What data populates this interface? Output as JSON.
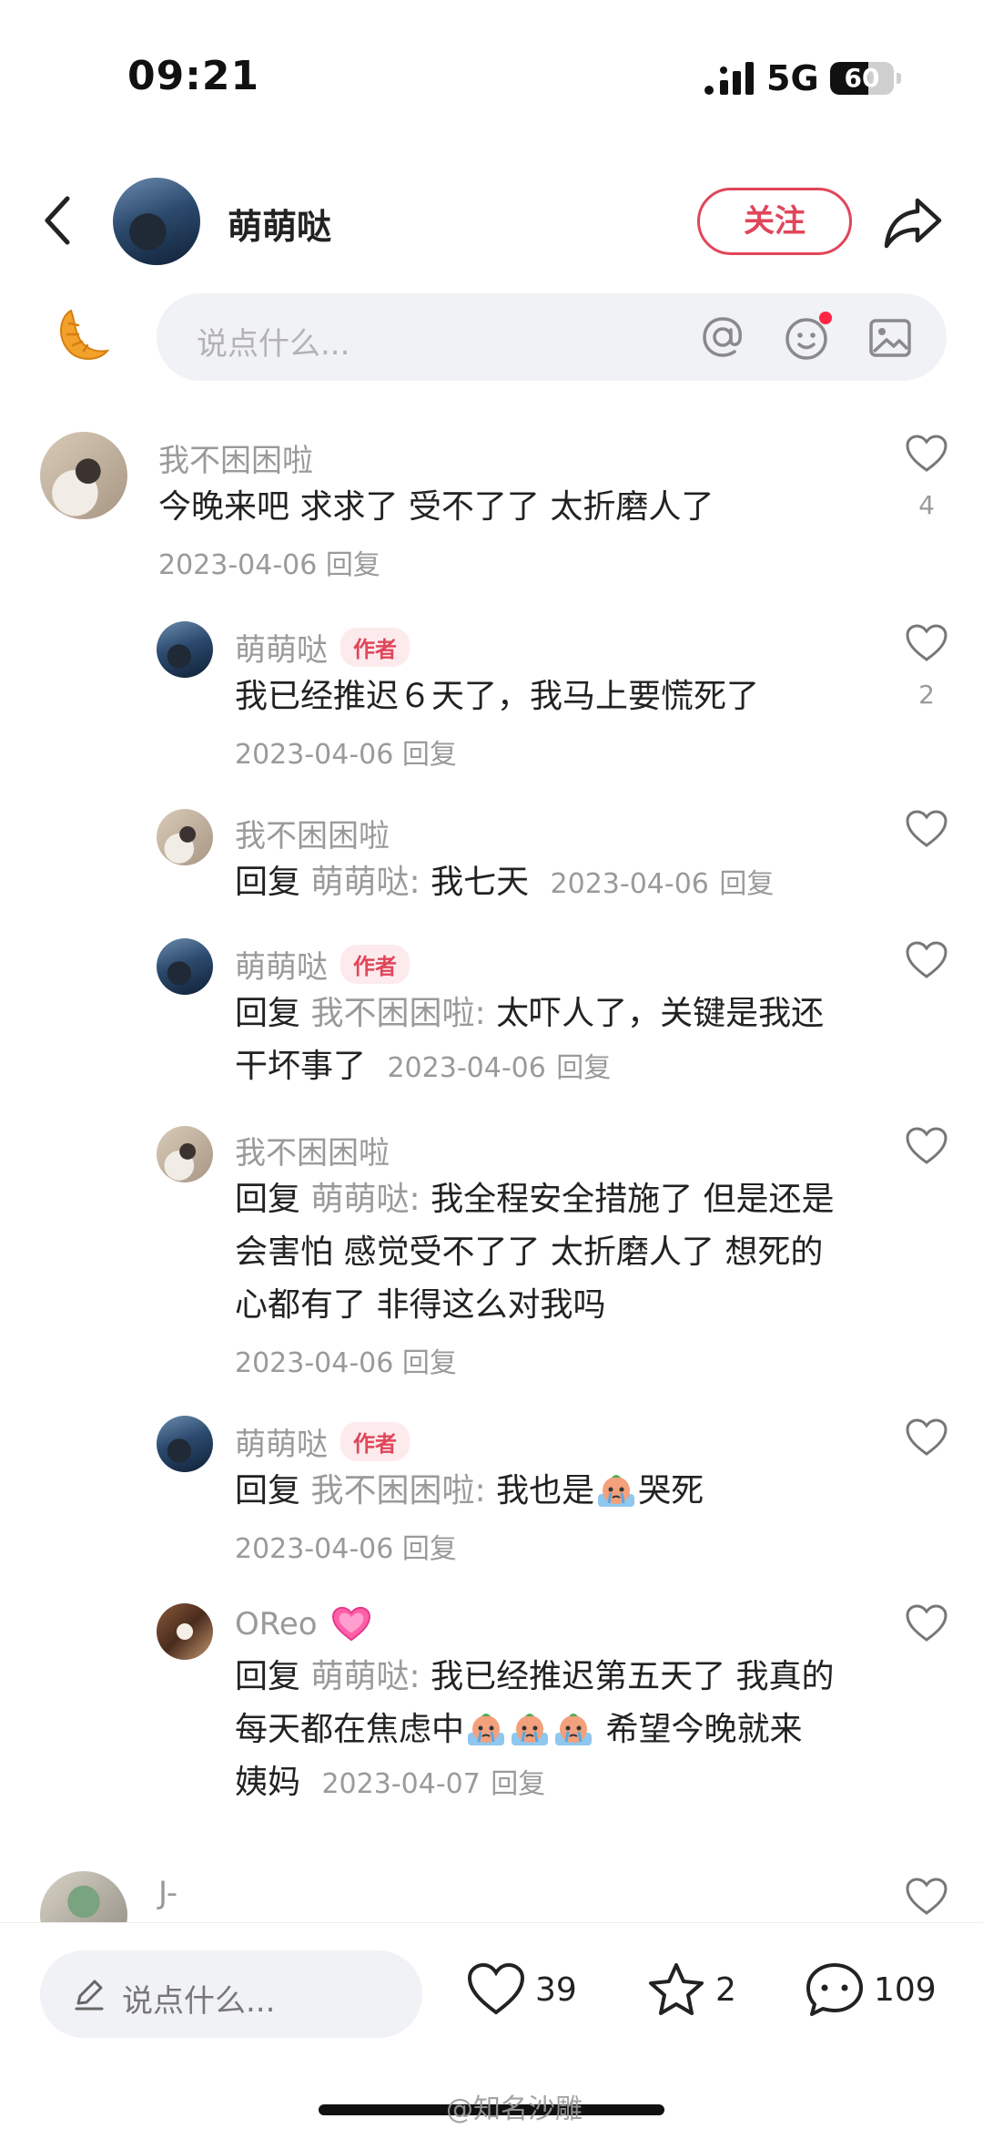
{
  "status_bar": {
    "time": "09:21",
    "network": "5G",
    "battery": "60",
    "battery_level": 0.6
  },
  "header": {
    "author_name": "萌萌哒",
    "follow_label": "关注"
  },
  "top_input": {
    "placeholder": "说点什么..."
  },
  "comments": [
    {
      "name": "我不困困啦",
      "text": "今晚来吧 求求了 受不了了 太折磨人了",
      "date": "2023-04-06",
      "reply_label": "回复",
      "likes": "4"
    },
    {
      "name": "萌萌哒",
      "tag": "作者",
      "text": "我已经推迟６天了，我马上要慌死了",
      "date": "2023-04-06",
      "reply_label": "回复",
      "likes": "2"
    },
    {
      "name": "我不困困啦",
      "prefix": "回复",
      "target": "萌萌哒:",
      "text": "我七天",
      "date": "2023-04-06",
      "reply_label": "回复"
    },
    {
      "name": "萌萌哒",
      "tag": "作者",
      "prefix": "回复",
      "target": "我不困困啦:",
      "text_line1": "太吓人了，关键是我还",
      "text_line2": "干坏事了",
      "date": "2023-04-06",
      "reply_label": "回复"
    },
    {
      "name": "我不困困啦",
      "prefix": "回复",
      "target": "萌萌哒:",
      "text_line1": "我全程安全措施了 但是还是",
      "text_line2": "会害怕 感觉受不了了 太折磨人了 想死的",
      "text_line3": "心都有了 非得这么对我吗",
      "date": "2023-04-06",
      "reply_label": "回复"
    },
    {
      "name": "萌萌哒",
      "tag": "作者",
      "prefix": "回复",
      "target": "我不困困啦:",
      "text_a": "我也是",
      "text_b": "哭死",
      "emoji": "crying-emoji",
      "date": "2023-04-06",
      "reply_label": "回复"
    },
    {
      "name": "OReo",
      "prefix": "回复",
      "target": "萌萌哒:",
      "text_line1": "我已经推迟第五天了 我真的",
      "text_line2a": "每天都在焦虑中",
      "text_line2b": "希望今晚就来",
      "text_line3": "姨妈",
      "emoji": "crying-emoji",
      "date": "2023-04-07",
      "reply_label": "回复"
    },
    {
      "name": "J-"
    }
  ],
  "bottom_bar": {
    "input_placeholder": "说点什么...",
    "likes": "39",
    "favorites": "2",
    "comments": "109"
  },
  "watermark": "@知名沙雕",
  "colors": {
    "accent": "#e0465a",
    "muted": "#9a9a9a",
    "input_bg": "#f1f2f5"
  }
}
